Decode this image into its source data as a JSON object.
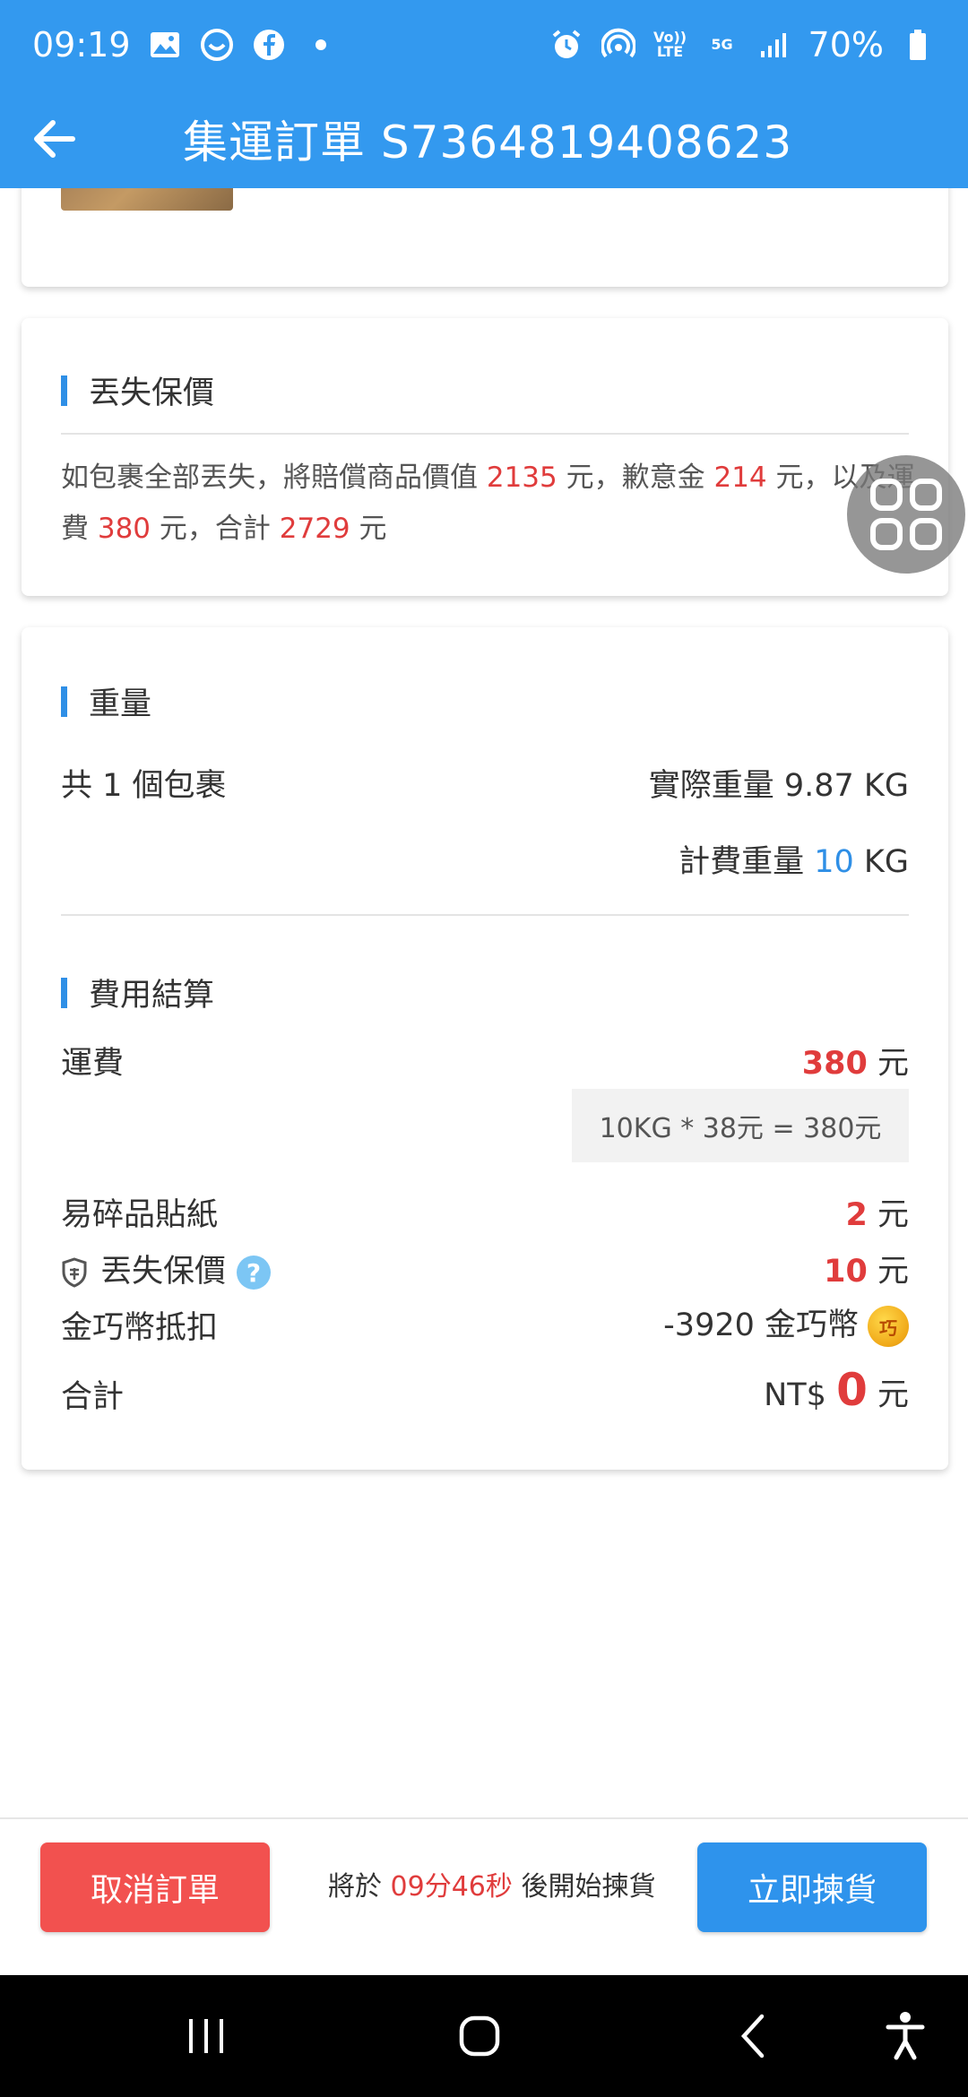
{
  "status_bar": {
    "time": "09:19",
    "battery": "70%",
    "icons": [
      "gallery-icon",
      "chat-icon",
      "facebook-icon",
      "dot-icon",
      "alarm-icon",
      "hotspot-icon",
      "volte-icon",
      "5g-icon",
      "signal-icon",
      "battery-icon"
    ],
    "volte_label": "Vo)) LTE",
    "net_label": "5G"
  },
  "header": {
    "title": "集運訂單 S7364819408623"
  },
  "insurance": {
    "title": "丟失保價",
    "text_1": "如包裹全部丟失，將賠償商品價值 ",
    "value": "2135",
    "text_2": " 元，歉意金 ",
    "apology": "214",
    "text_3": " 元，以及運費 ",
    "shipping": "380",
    "text_4": " 元，合計 ",
    "total": "2729",
    "text_5": " 元"
  },
  "weight": {
    "title": "重量",
    "packages": "共 1 個包裹",
    "actual_label": "實際重量 9.87 KG",
    "billed_label": "計費重量 ",
    "billed_value": "10",
    "billed_unit": " KG"
  },
  "fees": {
    "title": "費用結算",
    "shipping_label": "運費",
    "shipping_value": "380",
    "unit": " 元",
    "shipping_calc": "10KG * 38元 = 380元",
    "sticker_label": "易碎品貼紙",
    "sticker_value": "2",
    "insurance_label": "丟失保價",
    "insurance_value": "10",
    "coin_label": "金巧幣抵扣",
    "coin_value": "-3920 金巧幣",
    "coin_glyph": "巧",
    "total_label": "合計",
    "total_prefix": "NT$ ",
    "total_value": "0"
  },
  "bottom": {
    "cancel_label": "取消訂單",
    "countdown_prefix": "將於 ",
    "countdown_time": "09分46秒",
    "countdown_suffix": " 後開始揀貨",
    "pick_label": "立即揀貨"
  },
  "colors": {
    "primary": "#3399ef",
    "accent_red": "#e03c3c",
    "cancel_red": "#f2514f",
    "pick_blue": "#2e93ec"
  }
}
